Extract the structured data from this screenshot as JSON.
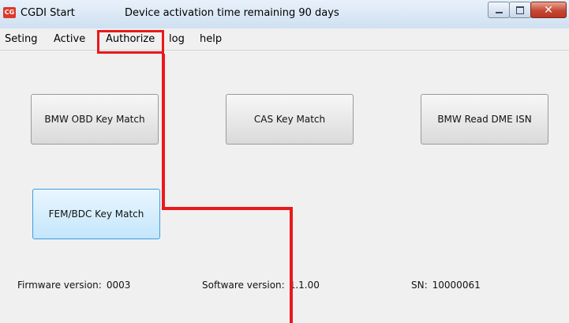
{
  "window": {
    "app_title": "CGDI Start",
    "app_icon_text": "CG",
    "activation_text": "Device activation time remaining 90 days"
  },
  "menu": {
    "items": [
      "Seting",
      "Active",
      "Authorize",
      "log",
      "help"
    ],
    "highlighted": "Authorize"
  },
  "buttons": {
    "bmw_obd_key_match": "BMW OBD Key Match",
    "cas_key_match": "CAS Key Match",
    "bmw_read_dme_isn": "BMW Read DME ISN",
    "fem_bdc_key_match": "FEM/BDC Key Match"
  },
  "status": {
    "firmware_label": "Firmware version:",
    "firmware_value": "0003",
    "software_label": "Software version:",
    "software_value": "1.1.00",
    "sn_label": "SN:",
    "sn_value": "10000061"
  },
  "colors": {
    "annotation_red": "#e8191c",
    "focused_button": "#c4e6fb"
  }
}
